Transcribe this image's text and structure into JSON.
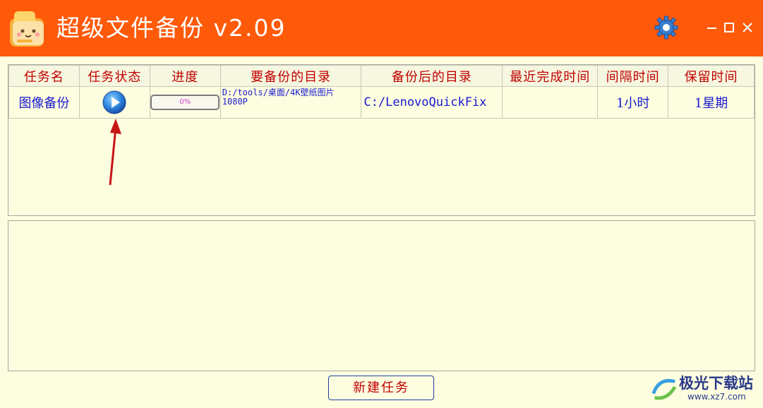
{
  "app": {
    "title": "超级文件备份  v2.09"
  },
  "table": {
    "headers": [
      "任务名",
      "任务状态",
      "进度",
      "要备份的目录",
      "备份后的目录",
      "最近完成时间",
      "间隔时间",
      "保留时间"
    ],
    "rows": [
      {
        "name": "图像备份",
        "status_icon": "play-icon",
        "progress": "0%",
        "progress_value": 0,
        "source_dir": "D:/tools/桌面/4K壁纸图片1080P",
        "dest_dir": "C:/LenovoQuickFix",
        "last_completed": "",
        "interval": "1小时",
        "retention": "1星期"
      }
    ]
  },
  "buttons": {
    "new_task": "新建任务"
  },
  "watermark": {
    "line1": "极光下载站",
    "line2": "www.xz7.com"
  },
  "colors": {
    "titlebar": "#ff5a0a",
    "background": "#fdfde0",
    "header_text": "#c00000",
    "cell_text": "#1a1ad0"
  }
}
